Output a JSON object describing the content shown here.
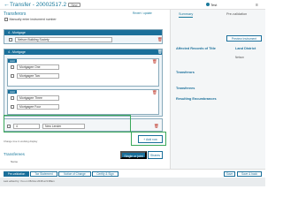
{
  "header": {
    "back": "←",
    "title": "Transfer - 20002517.2",
    "badge": "New",
    "user": "Test",
    "menu": "≡"
  },
  "main": {
    "section_title": "Transferors",
    "revert": "Revert / update",
    "manual_label": "Manually enter instrument number",
    "mortgage1_head": "4 - Mortgage",
    "mortgage1_field": "Nelson Building Society",
    "mortgage2_head": "4 - Mortgage",
    "chip1": "Joint",
    "field_one": "Mortgagee One",
    "field_two": "Mortgagee Two",
    "chip2": "Joint",
    "field_three": "Mortgagee Three",
    "field_four": "Mortgagee Four",
    "row_ref": "4",
    "row_new": "New Lender",
    "add_button": "+ Add row",
    "change_note": "Change true in working display",
    "single_button": "Single or joint",
    "shares_button": "Shares",
    "transferees": "Transferees",
    "name_label": "Name"
  },
  "right": {
    "tab_summary": "Summary",
    "tab_prevalidation": "Pre-validation",
    "preview_button": "Preview Instrument",
    "affected_label": "Affected Records of Title",
    "land_district_label": "Land District",
    "land_district_value": "Nelson",
    "transferors_label": "Transferors",
    "transferees_label": "Transferees",
    "resulting_label": "Resulting Encumbrances"
  },
  "bottom": {
    "tabs": [
      "Pre-validation",
      "Tax Statement",
      "Notice of Change",
      "Certify & Sign"
    ],
    "save": "Save",
    "save_back": "Save & back",
    "status": "Last edited by: You on 08-Nov-2018 at 9:08am"
  },
  "colors": {
    "accent": "#1a6f9a",
    "highlight": "#3aa85a",
    "delete": "#c0392b"
  }
}
